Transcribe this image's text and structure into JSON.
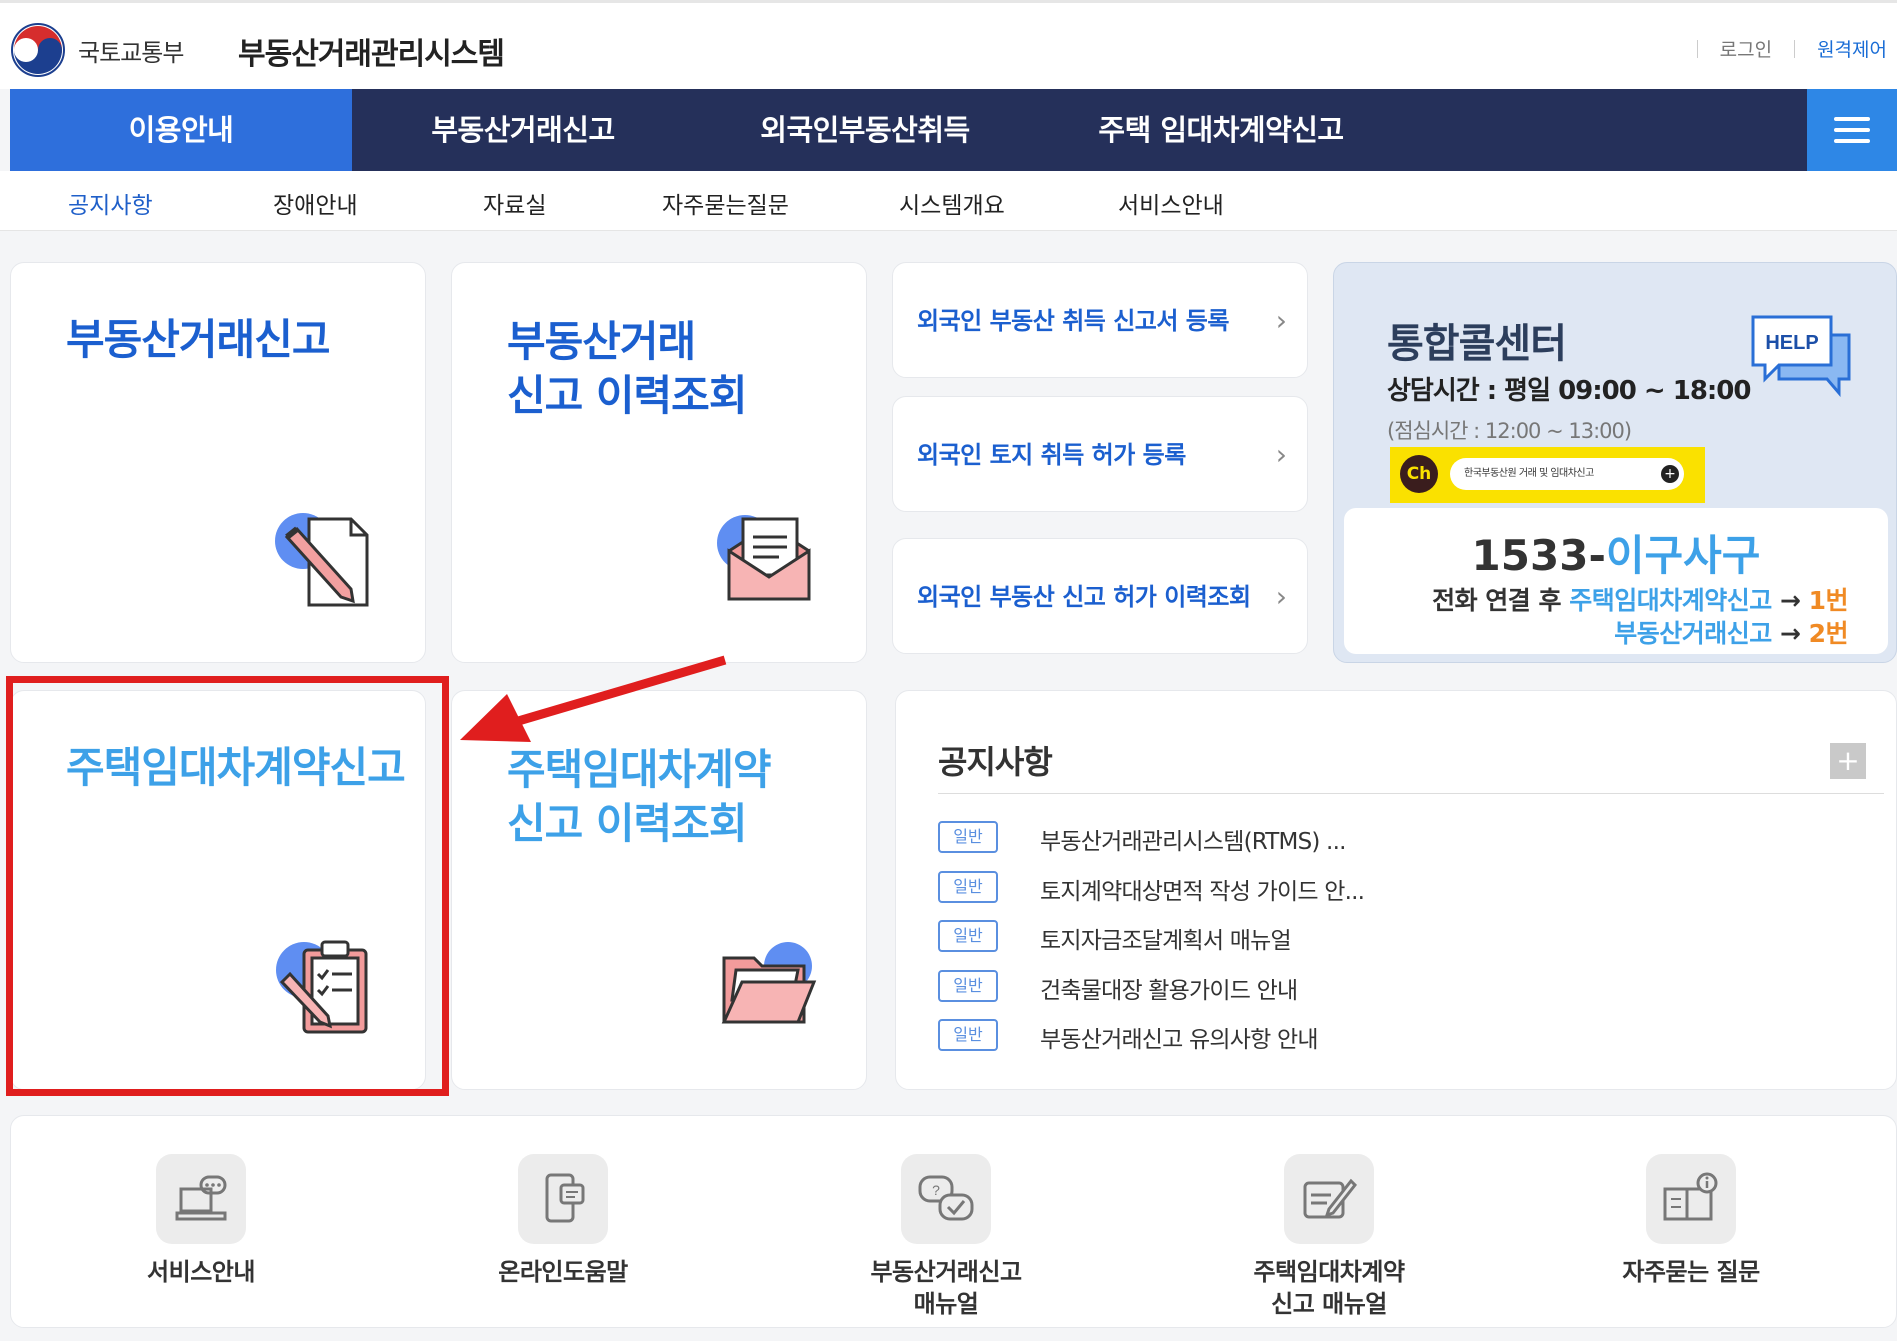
{
  "header": {
    "ministry": "국토교통부",
    "system_name": "부동산거래관리시스템",
    "login": "로그인",
    "remote": "원격제어"
  },
  "gnb": [
    "이용안내",
    "부동산거래신고",
    "외국인부동산취득",
    "주택 임대차계약신고"
  ],
  "lnb": [
    "공지사항",
    "장애안내",
    "자료실",
    "자주묻는질문",
    "시스템개요",
    "서비스안내"
  ],
  "cards": {
    "trade_report": "부동산거래신고",
    "trade_history": "부동산거래\n신고 이력조회",
    "lease_report": "주택임대차계약신고",
    "lease_history": "주택임대차계약\n신고 이력조회"
  },
  "foreign_links": [
    "외국인 부동산 취득 신고서 등록",
    "외국인 토지 취득 허가 등록",
    "외국인 부동산 신고 허가 이력조회"
  ],
  "call_center": {
    "title": "통합콜센터",
    "hours": "상담시간 : 평일 09:00 ~ 18:00",
    "lunch": "(점심시간 : 12:00 ~ 13:00)",
    "kakao_text": "한국부동산원 거래 및 임대차신고",
    "help": "HELP",
    "number_prefix": "1533-",
    "number_words": "이구사구",
    "line1_prefix": "전화 연결 후 ",
    "line1_target": "주택임대차계약신고",
    "line1_arrow": " → ",
    "line1_num": "1번",
    "line2_target": "부동산거래신고",
    "line2_arrow": " → ",
    "line2_num": "2번"
  },
  "notice": {
    "title": "공지사항",
    "more": "+",
    "items": [
      {
        "badge": "일반",
        "text": "부동산거래관리시스템(RTMS) ..."
      },
      {
        "badge": "일반",
        "text": "토지계약대상면적 작성 가이드 안..."
      },
      {
        "badge": "일반",
        "text": "토지자금조달계획서 매뉴얼"
      },
      {
        "badge": "일반",
        "text": "건축물대장 활용가이드 안내"
      },
      {
        "badge": "일반",
        "text": "부동산거래신고 유의사항 안내"
      }
    ]
  },
  "quick": [
    {
      "label": "서비스안내",
      "icon": "book-chat-icon"
    },
    {
      "label": "온라인도움말",
      "icon": "mobile-help-icon"
    },
    {
      "label": "부동산거래신고\n매뉴얼",
      "icon": "question-chat-icon"
    },
    {
      "label": "주택임대차계약\n신고 매뉴얼",
      "icon": "edit-document-icon"
    },
    {
      "label": "자주묻는 질문",
      "icon": "info-book-icon"
    }
  ],
  "colors": {
    "navy": "#25305a",
    "accent_blue": "#2e6fdc",
    "highlight_red": "#e01e1e"
  }
}
